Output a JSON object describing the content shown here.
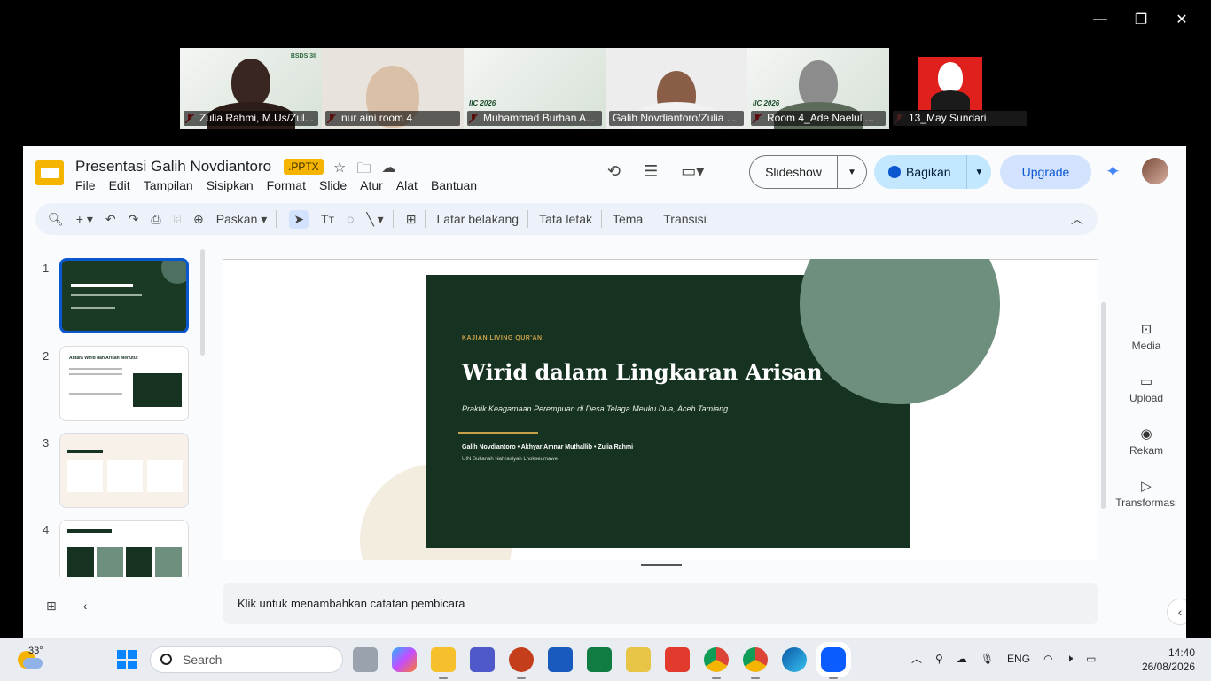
{
  "window_controls": {
    "minimize": "—",
    "restore": "❐",
    "close": "✕"
  },
  "participants": [
    {
      "name": "Zulia Rahmi, M.Us/Zul...",
      "muted": true,
      "tag": "BSDS 3II"
    },
    {
      "name": "nur aini room 4",
      "muted": true
    },
    {
      "name": "Muhammad Burhan A...",
      "muted": true,
      "tag": "IIC 2026"
    },
    {
      "name": "Galih Novdiantoro/Zulia ...",
      "muted": false,
      "active": true
    },
    {
      "name": "Room 4_Ade Naelul ...",
      "muted": true,
      "tag": "IIC 2026"
    },
    {
      "name": "13_May Sundari",
      "muted": true
    }
  ],
  "app": {
    "title": "Presentasi Galih Novdiantoro",
    "badge": ".PPTX",
    "menu": [
      "File",
      "Edit",
      "Tampilan",
      "Sisipkan",
      "Format",
      "Slide",
      "Atur",
      "Alat",
      "Bantuan"
    ],
    "slideshow_label": "Slideshow",
    "share_label": "Bagikan",
    "upgrade_label": "Upgrade"
  },
  "toolbar": {
    "zoom_label": "Paskan",
    "items": [
      "Latar belakang",
      "Tata letak",
      "Tema",
      "Transisi"
    ]
  },
  "filmstrip": {
    "numbers": [
      "1",
      "2",
      "3",
      "4"
    ],
    "thumb2_title": "Antara Wirid dan Arisan Menutut"
  },
  "slide": {
    "kicker": "KAJIAN LIVING QUR'AN",
    "title": "Wirid dalam Lingkaran Arisan",
    "subtitle": "Praktik Keagamaan Perempuan di Desa Telaga Meuku Dua, Aceh Tamiang",
    "authors": "Galih Novdiantoro  •  Akhyar Amnar Muthallib  •  Zulia Rahmi",
    "institution": "UIN Sultanah Nahrasiyah Lhokseumawe"
  },
  "side_panel": [
    {
      "icon": "media-icon",
      "label": "Media"
    },
    {
      "icon": "upload-icon",
      "label": "Upload"
    },
    {
      "icon": "record-icon",
      "label": "Rekam"
    },
    {
      "icon": "transform-icon",
      "label": "Transformasi"
    }
  ],
  "notes_placeholder": "Klik untuk menambahkan catatan pembicara",
  "taskbar": {
    "temperature": "33°",
    "search_placeholder": "Search",
    "language": "ENG",
    "time": "14:40",
    "date": "26/08/2026"
  }
}
